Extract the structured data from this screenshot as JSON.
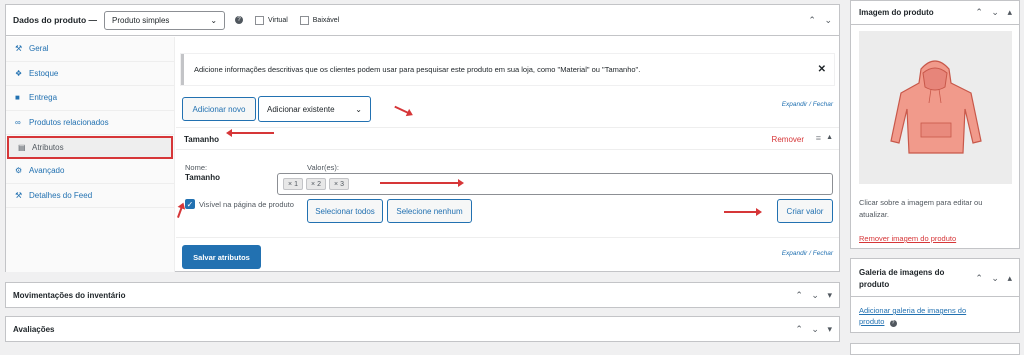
{
  "product_data": {
    "label": "Dados do produto —",
    "type_select": "Produto simples",
    "virtual": "Virtual",
    "downloadable": "Baixável"
  },
  "sidebar": {
    "items": [
      {
        "label": "Geral",
        "icon": "wrench-icon"
      },
      {
        "label": "Estoque",
        "icon": "inventory-icon"
      },
      {
        "label": "Entrega",
        "icon": "truck-icon"
      },
      {
        "label": "Produtos relacionados",
        "icon": "link-icon"
      },
      {
        "label": "Atributos",
        "icon": "table-icon"
      },
      {
        "label": "Avançado",
        "icon": "gear-icon"
      },
      {
        "label": "Detalhes do Feed",
        "icon": "wrench-icon"
      }
    ]
  },
  "attributes": {
    "notice": "Adicione informações descritivas que os clientes podem usar para pesquisar este produto em sua loja, como \"Material\" ou \"Tamanho\".",
    "add_new": "Adicionar novo",
    "add_existing": "Adicionar existente",
    "expand_close": "Expandir / Fechar",
    "attr_title": "Tamanho",
    "remove": "Remover",
    "name_label": "Nome:",
    "name_value": "Tamanho",
    "values_label": "Valor(es):",
    "values": [
      "1",
      "2",
      "3"
    ],
    "visible_label": "Visível na página de produto",
    "select_all": "Selecionar todos",
    "select_none": "Selecione nenhum",
    "create_value": "Criar valor",
    "save": "Salvar atributos",
    "expand_close_bottom": "Expandir / Fechar"
  },
  "boxes": {
    "inventory": "Movimentações do inventário",
    "reviews": "Avaliações"
  },
  "right": {
    "image_title": "Imagem do produto",
    "image_help": "Clicar sobre a imagem para editar ou atualizar.",
    "remove_image": "Remover imagem do produto",
    "gallery_title": "Galeria de imagens do produto",
    "add_gallery": "Adicionar galeria de imagens do produto"
  },
  "colors": {
    "accent": "#2271b1",
    "danger": "#d63638",
    "primary": "#2271b1"
  }
}
